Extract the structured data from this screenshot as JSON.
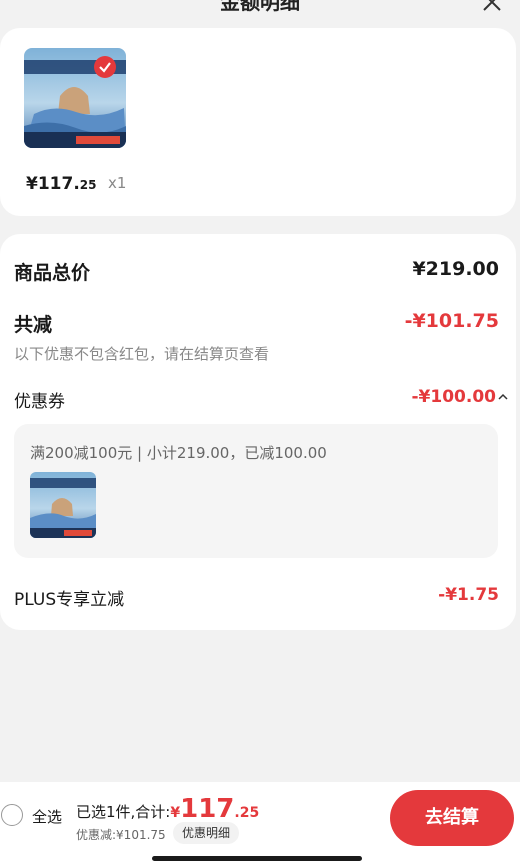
{
  "header": {
    "title": "金额明细"
  },
  "product": {
    "price_main": "¥117.",
    "price_cents": "25",
    "quantity": "x1",
    "thumb_banner": "布莱德可水洗凉被",
    "thumb_brand": "BRAD COOLING COMFORTER"
  },
  "summary": {
    "total_label": "商品总价",
    "total_value": "¥219.00",
    "reduce_label": "共减",
    "reduce_value": "-¥101.75",
    "note": "以下优惠不包含红包，请在结算页查看",
    "coupon_label": "优惠券",
    "coupon_value": "-¥100.00",
    "coupon_desc": "满200减100元 | 小计219.00，已减100.00",
    "plus_label": "PLUS专享立减",
    "plus_value": "-¥1.75"
  },
  "bottom": {
    "select_all": "全选",
    "selected_text": "已选1件,合计:",
    "total_symbol": "¥",
    "total_int": "117",
    "total_cents": ".25",
    "discount_text": "优惠减:¥101.75",
    "detail_button": "优惠明细",
    "checkout_button": "去结算"
  },
  "colors": {
    "accent_red": "#e4393c"
  }
}
